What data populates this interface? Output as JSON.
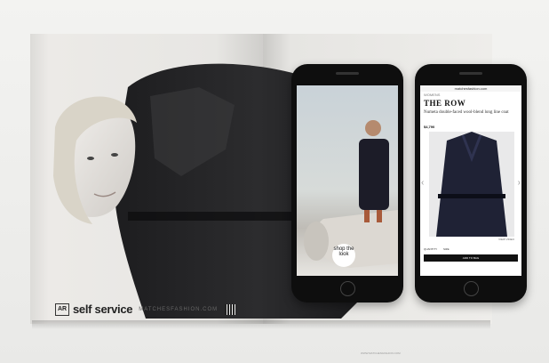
{
  "ad": {
    "ar_badge": "AR",
    "headline": "self service",
    "url": "MATCHESFASHION.COM",
    "fine_print": "WWW.MATCHESFASHION.COM"
  },
  "phone_left": {
    "shop_tag": "shop the look"
  },
  "phone_right": {
    "url_bar": "matchesfashion.com",
    "retailer_tag": "WOMENS",
    "brand": "THE ROW",
    "product_name": "Numeta double-faced wool-blend long line coat",
    "price": "$4,790",
    "view_video": "VIEW VIDEO",
    "quantity_label": "QUANTITY",
    "size_label": "SIZE",
    "add_to_bag": "ADD TO BAG"
  }
}
